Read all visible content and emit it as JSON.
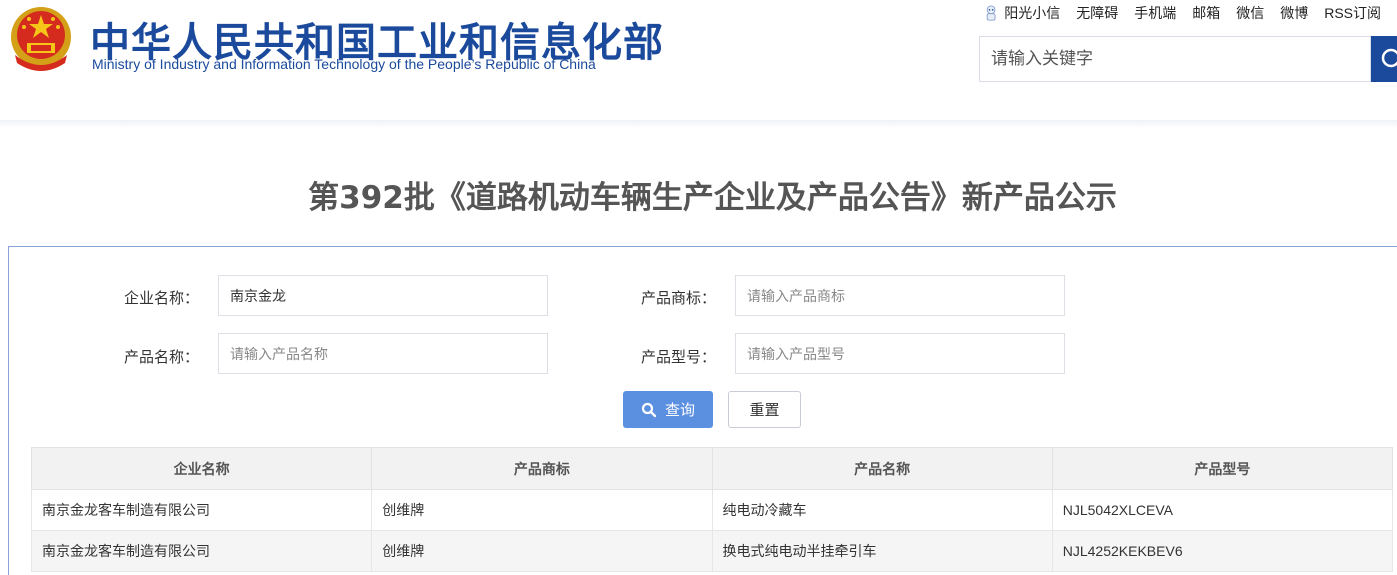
{
  "header": {
    "title_cn": "中华人民共和国工业和信息化部",
    "title_en": "Ministry of Industry and Information Technology of the People’s Republic of China",
    "emblem_icon": "national-emblem-icon",
    "toplinks": [
      "阳光小信",
      "无障碍",
      "手机端",
      "邮箱",
      "微信",
      "微博",
      "RSS订阅"
    ],
    "search": {
      "placeholder": "请输入关键字",
      "value": ""
    },
    "brand_color": "#1b4a9c"
  },
  "page": {
    "title": "第392批《道路机动车辆生产企业及产品公告》新产品公示"
  },
  "form": {
    "company_label": "企业名称：",
    "company_value": "南京金龙",
    "brand_label": "产品商标：",
    "brand_placeholder": "请输入产品商标",
    "product_label": "产品名称：",
    "product_placeholder": "请输入产品名称",
    "model_label": "产品型号：",
    "model_placeholder": "请输入产品型号",
    "query_label": "查询",
    "reset_label": "重置"
  },
  "table": {
    "headers": [
      "企业名称",
      "产品商标",
      "产品名称",
      "产品型号"
    ],
    "rows": [
      [
        "南京金龙客车制造有限公司",
        "创维牌",
        "纯电动冷藏车",
        "NJL5042XLCEVA"
      ],
      [
        "南京金龙客车制造有限公司",
        "创维牌",
        "换电式纯电动半挂牵引车",
        "NJL4252KEKBEV6"
      ]
    ]
  }
}
